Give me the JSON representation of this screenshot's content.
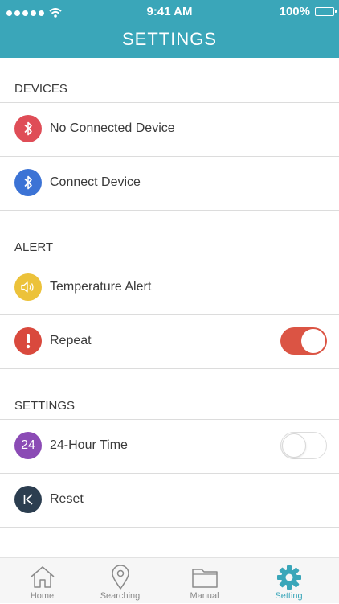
{
  "status_bar": {
    "time": "9:41 AM",
    "battery": "100%"
  },
  "header": {
    "title": "SETTINGS"
  },
  "sections": {
    "devices": {
      "label": "DEVICES",
      "rows": {
        "no_device": {
          "label": "No Connected Device",
          "icon": "bluetooth-icon",
          "color": "#df4d57"
        },
        "connect": {
          "label": "Connect Device",
          "icon": "bluetooth-icon",
          "color": "#3c73d5"
        }
      }
    },
    "alert": {
      "label": "ALERT",
      "rows": {
        "temperature": {
          "label": "Temperature Alert",
          "icon": "speaker-icon",
          "color": "#ecc23a"
        },
        "repeat": {
          "label": "Repeat",
          "icon": "exclamation-icon",
          "color": "#d9493d",
          "toggle": true
        }
      }
    },
    "settings": {
      "label": "SETTINGS",
      "rows": {
        "hour24": {
          "label": "24-Hour Time",
          "icon_text": "24",
          "color": "#8b4bb5",
          "toggle": false
        },
        "reset": {
          "label": "Reset",
          "icon": "skip-back-icon",
          "color": "#2c3e50"
        }
      }
    }
  },
  "tabbar": {
    "tabs": [
      {
        "label": "Home",
        "icon": "home-icon",
        "active": false
      },
      {
        "label": "Searching",
        "icon": "location-pin-icon",
        "active": false
      },
      {
        "label": "Manual",
        "icon": "folder-icon",
        "active": false
      },
      {
        "label": "Setting",
        "icon": "gear-icon",
        "active": true
      }
    ]
  },
  "colors": {
    "accent": "#3aa6b9",
    "toggle_on": "#db5444",
    "divider": "#dcdcdc",
    "tab_inactive": "#8a8a8a"
  }
}
